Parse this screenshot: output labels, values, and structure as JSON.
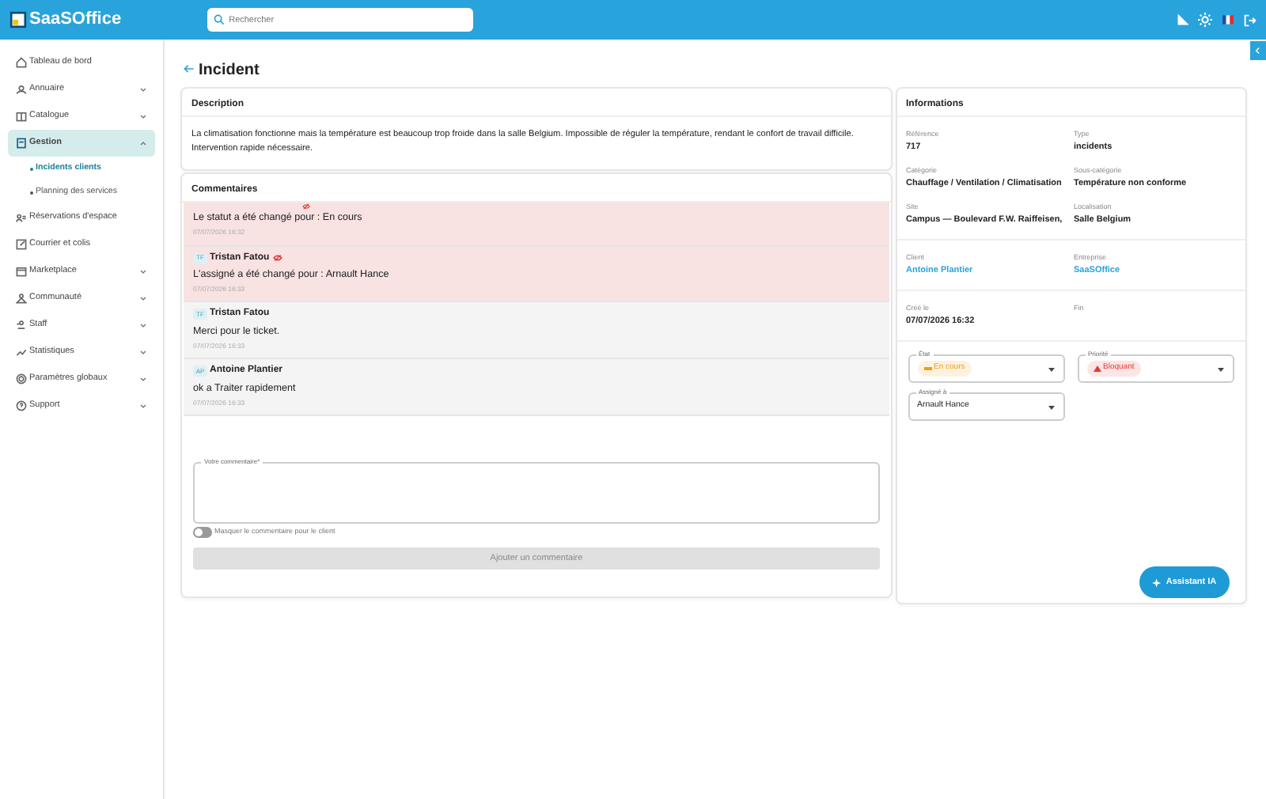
{
  "app": {
    "logo": "SaaSOffice"
  },
  "search": {
    "placeholder": "Rechercher"
  },
  "sidebar": {
    "items": [
      {
        "label": "Tableau de bord",
        "kind": "link",
        "selected": false
      },
      {
        "label": "Annuaire",
        "kind": "group",
        "selected": false,
        "expanded": false
      },
      {
        "label": "Catalogue",
        "kind": "group",
        "selected": false,
        "expanded": false
      },
      {
        "label": "Gestion",
        "kind": "group",
        "selected": true,
        "expanded": true,
        "children": [
          {
            "label": "Incidents clients",
            "selected": true
          },
          {
            "label": "Planning des services",
            "selected": false
          }
        ]
      },
      {
        "label": "Réservations d'espace",
        "kind": "link",
        "selected": false
      },
      {
        "label": "Courrier et colis",
        "kind": "link",
        "selected": false
      },
      {
        "label": "Marketplace",
        "kind": "group",
        "selected": false,
        "expanded": false
      },
      {
        "label": "Communauté",
        "kind": "group",
        "selected": false,
        "expanded": false
      },
      {
        "label": "Staff",
        "kind": "group",
        "selected": false,
        "expanded": false
      },
      {
        "label": "Statistiques",
        "kind": "group",
        "selected": false,
        "expanded": false
      },
      {
        "label": "Paramètres globaux",
        "kind": "group",
        "selected": false,
        "expanded": false
      },
      {
        "label": "Support",
        "kind": "group",
        "selected": false,
        "expanded": false
      }
    ]
  },
  "page": {
    "title": "Incident"
  },
  "description": {
    "title": "Description",
    "text": "La climatisation fonctionne mais la température est beaucoup trop froide dans la salle Belgium. Impossible de réguler la température, rendant le confort de travail difficile. Intervention rapide nécessaire."
  },
  "comments": {
    "title": "Commentaires",
    "items": [
      {
        "hidden": true,
        "text": "Le statut a été changé pour : En cours",
        "time": "07/07/2026 16:32"
      },
      {
        "initials": "TF",
        "author": "Tristan Fatou",
        "hidden": true,
        "text": "L'assigné a été changé pour : Arnault Hance",
        "time": "07/07/2026 16:33"
      },
      {
        "initials": "TF",
        "author": "Tristan Fatou",
        "hidden": false,
        "text": "Merci pour le ticket.",
        "time": "07/07/2026 16:33"
      },
      {
        "initials": "AP",
        "author": "Antoine Plantier",
        "hidden": false,
        "text": "ok a Traiter rapidement",
        "time": "07/07/2026 16:33"
      }
    ],
    "field": {
      "label": "Votre commentaire*"
    },
    "toggle": {
      "label": "Masquer le commentaire pour le client",
      "on": false
    },
    "button": {
      "label": "Ajouter un commentaire",
      "disabled": true
    }
  },
  "informations": {
    "title": "Informations",
    "groups": [
      [
        {
          "label": "Référence",
          "value": "717",
          "kind": "text"
        },
        {
          "label": "Type",
          "value": "incidents",
          "kind": "text"
        },
        {
          "label": "Catégorie",
          "value": "Chauffage / Ventilation / Climatisation",
          "kind": "text"
        },
        {
          "label": "Sous-catégorie",
          "value": "Température non conforme",
          "kind": "text"
        },
        {
          "label": "Site",
          "value": "Campus — Boulevard F.W. Raiffeisen,",
          "kind": "text"
        },
        {
          "label": "Localisation",
          "value": "Salle Belgium",
          "kind": "text"
        }
      ],
      [
        {
          "label": "Client",
          "value": "Antoine Plantier",
          "kind": "link"
        },
        {
          "label": "Entreprise",
          "value": "SaaSOffice",
          "kind": "link"
        }
      ],
      [
        {
          "label": "Créé le",
          "value": "07/07/2026 16:32",
          "kind": "text"
        },
        {
          "label": "Fin"
        }
      ]
    ],
    "selects": [
      {
        "label": "État",
        "value": "En cours",
        "kind": "dash",
        "color": "#f39c12"
      },
      {
        "label": "Priorité",
        "value": "Bloquant",
        "kind": "arrow",
        "color": "#e53935"
      },
      {
        "label": "Assigné à",
        "value": "Arnault Hance",
        "kind": "plain"
      }
    ]
  },
  "assistant": {
    "label": "Assistant IA"
  }
}
